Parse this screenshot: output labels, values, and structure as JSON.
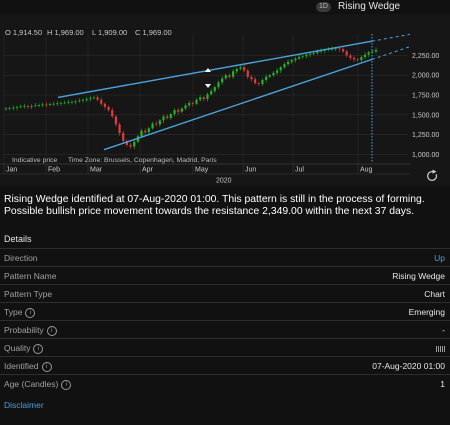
{
  "header": {
    "timeframe": "1D",
    "title": "Rising Wedge"
  },
  "ohlc": {
    "open": "O 1,914.50",
    "high": "H 1,969.00",
    "low": "L 1,909.00",
    "close": "C 1,969.00"
  },
  "chart_data": {
    "type": "candlestick",
    "title": "",
    "x_ticks": [
      "Jan",
      "Feb",
      "Mar",
      "Apr",
      "May",
      "Jun",
      "Jul",
      "Aug"
    ],
    "year_label": "2020",
    "y_ticks": [
      "2,250.00",
      "2,000.00",
      "1,750.00",
      "1,500.00",
      "1,250.00",
      "1,000.00"
    ],
    "ylim": [
      930,
      2470
    ],
    "closes_approx": [
      1580,
      1585,
      1590,
      1600,
      1605,
      1610,
      1605,
      1612,
      1620,
      1625,
      1630,
      1628,
      1635,
      1640,
      1645,
      1650,
      1655,
      1660,
      1665,
      1670,
      1680,
      1690,
      1700,
      1710,
      1720,
      1690,
      1640,
      1600,
      1560,
      1480,
      1380,
      1270,
      1170,
      1120,
      1100,
      1160,
      1230,
      1300,
      1280,
      1330,
      1390,
      1380,
      1430,
      1480,
      1460,
      1510,
      1560,
      1540,
      1580,
      1620,
      1650,
      1640,
      1690,
      1720,
      1700,
      1760,
      1800,
      1850,
      1910,
      1960,
      2000,
      1980,
      2050,
      2080,
      2100,
      2060,
      1980,
      1950,
      1900,
      1890,
      1940,
      1980,
      2000,
      2030,
      2060,
      2100,
      2140,
      2170,
      2190,
      2210,
      2230,
      2240,
      2260,
      2270,
      2280,
      2300,
      2310,
      2320,
      2330,
      2335,
      2340,
      2330,
      2300,
      2250,
      2220,
      2200,
      2190,
      2230,
      2260,
      2290,
      2300,
      2320
    ],
    "upper_trendline": {
      "start": [
        "Feb",
        1720
      ],
      "end": [
        "Aug",
        2430
      ]
    },
    "lower_trendline": {
      "start": [
        "Mar",
        1060
      ],
      "end": [
        "Aug",
        2200
      ]
    },
    "indicative_note": "Indicative price",
    "timezone_note": "Time Zone: Brussels, Copenhagen, Madrid, Paris"
  },
  "description": "Rising Wedge identified at 07-Aug-2020 01:00. This pattern is still in the process of forming. Possible bullish price movement towards the resistance 2,349.00 within the next 37 days.",
  "details": {
    "heading": "Details",
    "rows": [
      {
        "label": "Direction",
        "value": "Up"
      },
      {
        "label": "Pattern Name",
        "value": "Rising Wedge"
      },
      {
        "label": "Pattern Type",
        "value": "Chart"
      },
      {
        "label": "Type",
        "value": "Emerging"
      },
      {
        "label": "Probability",
        "value": "-"
      },
      {
        "label": "Quality",
        "value": ""
      },
      {
        "label": "Identified",
        "value": "07-Aug-2020 01:00"
      },
      {
        "label": "Age (Candles)",
        "value": "1"
      }
    ],
    "quality_bars": 5
  },
  "disclaimer": "Disclaimer",
  "colors": {
    "up": "#22b422",
    "down": "#e03c3c",
    "trend": "#4aa3df",
    "accent": "#4a9fe0"
  }
}
